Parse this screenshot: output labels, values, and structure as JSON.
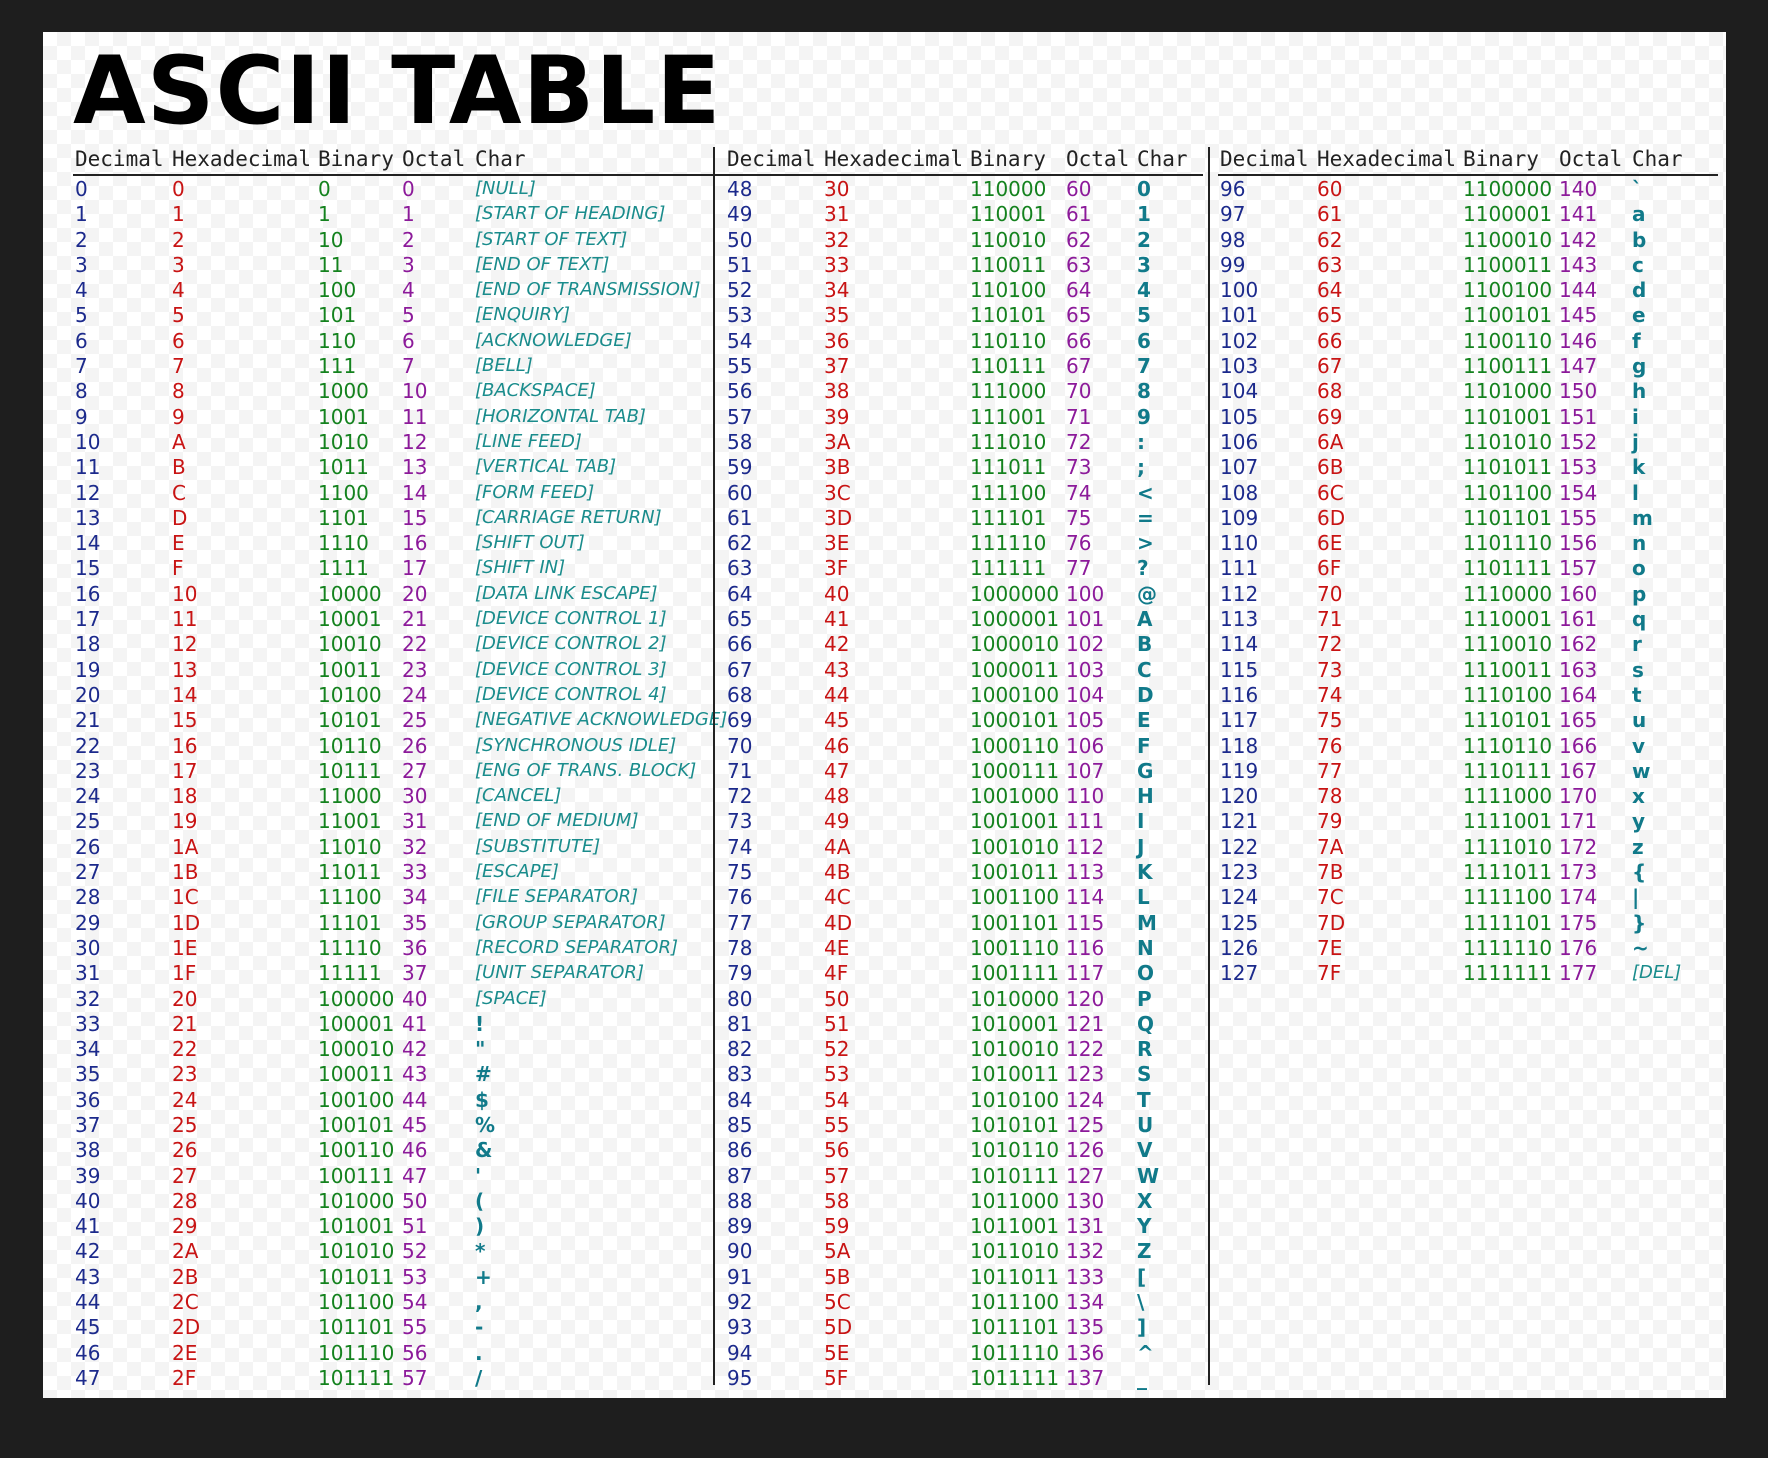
{
  "title": "ASCII TABLE",
  "headers": [
    "Decimal",
    "Hexadecimal",
    "Binary",
    "Octal",
    "Char"
  ],
  "rows": [
    [
      "0",
      "0",
      "0",
      "0",
      "[NULL]"
    ],
    [
      "1",
      "1",
      "1",
      "1",
      "[START OF HEADING]"
    ],
    [
      "2",
      "2",
      "10",
      "2",
      "[START OF TEXT]"
    ],
    [
      "3",
      "3",
      "11",
      "3",
      "[END OF TEXT]"
    ],
    [
      "4",
      "4",
      "100",
      "4",
      "[END OF TRANSMISSION]"
    ],
    [
      "5",
      "5",
      "101",
      "5",
      "[ENQUIRY]"
    ],
    [
      "6",
      "6",
      "110",
      "6",
      "[ACKNOWLEDGE]"
    ],
    [
      "7",
      "7",
      "111",
      "7",
      "[BELL]"
    ],
    [
      "8",
      "8",
      "1000",
      "10",
      "[BACKSPACE]"
    ],
    [
      "9",
      "9",
      "1001",
      "11",
      "[HORIZONTAL TAB]"
    ],
    [
      "10",
      "A",
      "1010",
      "12",
      "[LINE FEED]"
    ],
    [
      "11",
      "B",
      "1011",
      "13",
      "[VERTICAL TAB]"
    ],
    [
      "12",
      "C",
      "1100",
      "14",
      "[FORM FEED]"
    ],
    [
      "13",
      "D",
      "1101",
      "15",
      "[CARRIAGE RETURN]"
    ],
    [
      "14",
      "E",
      "1110",
      "16",
      "[SHIFT OUT]"
    ],
    [
      "15",
      "F",
      "1111",
      "17",
      "[SHIFT IN]"
    ],
    [
      "16",
      "10",
      "10000",
      "20",
      "[DATA LINK ESCAPE]"
    ],
    [
      "17",
      "11",
      "10001",
      "21",
      "[DEVICE CONTROL 1]"
    ],
    [
      "18",
      "12",
      "10010",
      "22",
      "[DEVICE CONTROL 2]"
    ],
    [
      "19",
      "13",
      "10011",
      "23",
      "[DEVICE CONTROL 3]"
    ],
    [
      "20",
      "14",
      "10100",
      "24",
      "[DEVICE CONTROL 4]"
    ],
    [
      "21",
      "15",
      "10101",
      "25",
      "[NEGATIVE ACKNOWLEDGE]"
    ],
    [
      "22",
      "16",
      "10110",
      "26",
      "[SYNCHRONOUS IDLE]"
    ],
    [
      "23",
      "17",
      "10111",
      "27",
      "[ENG OF TRANS. BLOCK]"
    ],
    [
      "24",
      "18",
      "11000",
      "30",
      "[CANCEL]"
    ],
    [
      "25",
      "19",
      "11001",
      "31",
      "[END OF MEDIUM]"
    ],
    [
      "26",
      "1A",
      "11010",
      "32",
      "[SUBSTITUTE]"
    ],
    [
      "27",
      "1B",
      "11011",
      "33",
      "[ESCAPE]"
    ],
    [
      "28",
      "1C",
      "11100",
      "34",
      "[FILE SEPARATOR]"
    ],
    [
      "29",
      "1D",
      "11101",
      "35",
      "[GROUP SEPARATOR]"
    ],
    [
      "30",
      "1E",
      "11110",
      "36",
      "[RECORD SEPARATOR]"
    ],
    [
      "31",
      "1F",
      "11111",
      "37",
      "[UNIT SEPARATOR]"
    ],
    [
      "32",
      "20",
      "100000",
      "40",
      "[SPACE]"
    ],
    [
      "33",
      "21",
      "100001",
      "41",
      "!"
    ],
    [
      "34",
      "22",
      "100010",
      "42",
      "\""
    ],
    [
      "35",
      "23",
      "100011",
      "43",
      "#"
    ],
    [
      "36",
      "24",
      "100100",
      "44",
      "$"
    ],
    [
      "37",
      "25",
      "100101",
      "45",
      "%"
    ],
    [
      "38",
      "26",
      "100110",
      "46",
      "&"
    ],
    [
      "39",
      "27",
      "100111",
      "47",
      "'"
    ],
    [
      "40",
      "28",
      "101000",
      "50",
      "("
    ],
    [
      "41",
      "29",
      "101001",
      "51",
      ")"
    ],
    [
      "42",
      "2A",
      "101010",
      "52",
      "*"
    ],
    [
      "43",
      "2B",
      "101011",
      "53",
      "+"
    ],
    [
      "44",
      "2C",
      "101100",
      "54",
      ","
    ],
    [
      "45",
      "2D",
      "101101",
      "55",
      "-"
    ],
    [
      "46",
      "2E",
      "101110",
      "56",
      "."
    ],
    [
      "47",
      "2F",
      "101111",
      "57",
      "/"
    ],
    [
      "48",
      "30",
      "110000",
      "60",
      "0"
    ],
    [
      "49",
      "31",
      "110001",
      "61",
      "1"
    ],
    [
      "50",
      "32",
      "110010",
      "62",
      "2"
    ],
    [
      "51",
      "33",
      "110011",
      "63",
      "3"
    ],
    [
      "52",
      "34",
      "110100",
      "64",
      "4"
    ],
    [
      "53",
      "35",
      "110101",
      "65",
      "5"
    ],
    [
      "54",
      "36",
      "110110",
      "66",
      "6"
    ],
    [
      "55",
      "37",
      "110111",
      "67",
      "7"
    ],
    [
      "56",
      "38",
      "111000",
      "70",
      "8"
    ],
    [
      "57",
      "39",
      "111001",
      "71",
      "9"
    ],
    [
      "58",
      "3A",
      "111010",
      "72",
      ":"
    ],
    [
      "59",
      "3B",
      "111011",
      "73",
      ";"
    ],
    [
      "60",
      "3C",
      "111100",
      "74",
      "<"
    ],
    [
      "61",
      "3D",
      "111101",
      "75",
      "="
    ],
    [
      "62",
      "3E",
      "111110",
      "76",
      ">"
    ],
    [
      "63",
      "3F",
      "111111",
      "77",
      "?"
    ],
    [
      "64",
      "40",
      "1000000",
      "100",
      "@"
    ],
    [
      "65",
      "41",
      "1000001",
      "101",
      "A"
    ],
    [
      "66",
      "42",
      "1000010",
      "102",
      "B"
    ],
    [
      "67",
      "43",
      "1000011",
      "103",
      "C"
    ],
    [
      "68",
      "44",
      "1000100",
      "104",
      "D"
    ],
    [
      "69",
      "45",
      "1000101",
      "105",
      "E"
    ],
    [
      "70",
      "46",
      "1000110",
      "106",
      "F"
    ],
    [
      "71",
      "47",
      "1000111",
      "107",
      "G"
    ],
    [
      "72",
      "48",
      "1001000",
      "110",
      "H"
    ],
    [
      "73",
      "49",
      "1001001",
      "111",
      "I"
    ],
    [
      "74",
      "4A",
      "1001010",
      "112",
      "J"
    ],
    [
      "75",
      "4B",
      "1001011",
      "113",
      "K"
    ],
    [
      "76",
      "4C",
      "1001100",
      "114",
      "L"
    ],
    [
      "77",
      "4D",
      "1001101",
      "115",
      "M"
    ],
    [
      "78",
      "4E",
      "1001110",
      "116",
      "N"
    ],
    [
      "79",
      "4F",
      "1001111",
      "117",
      "O"
    ],
    [
      "80",
      "50",
      "1010000",
      "120",
      "P"
    ],
    [
      "81",
      "51",
      "1010001",
      "121",
      "Q"
    ],
    [
      "82",
      "52",
      "1010010",
      "122",
      "R"
    ],
    [
      "83",
      "53",
      "1010011",
      "123",
      "S"
    ],
    [
      "84",
      "54",
      "1010100",
      "124",
      "T"
    ],
    [
      "85",
      "55",
      "1010101",
      "125",
      "U"
    ],
    [
      "86",
      "56",
      "1010110",
      "126",
      "V"
    ],
    [
      "87",
      "57",
      "1010111",
      "127",
      "W"
    ],
    [
      "88",
      "58",
      "1011000",
      "130",
      "X"
    ],
    [
      "89",
      "59",
      "1011001",
      "131",
      "Y"
    ],
    [
      "90",
      "5A",
      "1011010",
      "132",
      "Z"
    ],
    [
      "91",
      "5B",
      "1011011",
      "133",
      "["
    ],
    [
      "92",
      "5C",
      "1011100",
      "134",
      "\\"
    ],
    [
      "93",
      "5D",
      "1011101",
      "135",
      "]"
    ],
    [
      "94",
      "5E",
      "1011110",
      "136",
      "^"
    ],
    [
      "95",
      "5F",
      "1011111",
      "137",
      "_"
    ],
    [
      "96",
      "60",
      "1100000",
      "140",
      "`"
    ],
    [
      "97",
      "61",
      "1100001",
      "141",
      "a"
    ],
    [
      "98",
      "62",
      "1100010",
      "142",
      "b"
    ],
    [
      "99",
      "63",
      "1100011",
      "143",
      "c"
    ],
    [
      "100",
      "64",
      "1100100",
      "144",
      "d"
    ],
    [
      "101",
      "65",
      "1100101",
      "145",
      "e"
    ],
    [
      "102",
      "66",
      "1100110",
      "146",
      "f"
    ],
    [
      "103",
      "67",
      "1100111",
      "147",
      "g"
    ],
    [
      "104",
      "68",
      "1101000",
      "150",
      "h"
    ],
    [
      "105",
      "69",
      "1101001",
      "151",
      "i"
    ],
    [
      "106",
      "6A",
      "1101010",
      "152",
      "j"
    ],
    [
      "107",
      "6B",
      "1101011",
      "153",
      "k"
    ],
    [
      "108",
      "6C",
      "1101100",
      "154",
      "l"
    ],
    [
      "109",
      "6D",
      "1101101",
      "155",
      "m"
    ],
    [
      "110",
      "6E",
      "1101110",
      "156",
      "n"
    ],
    [
      "111",
      "6F",
      "1101111",
      "157",
      "o"
    ],
    [
      "112",
      "70",
      "1110000",
      "160",
      "p"
    ],
    [
      "113",
      "71",
      "1110001",
      "161",
      "q"
    ],
    [
      "114",
      "72",
      "1110010",
      "162",
      "r"
    ],
    [
      "115",
      "73",
      "1110011",
      "163",
      "s"
    ],
    [
      "116",
      "74",
      "1110100",
      "164",
      "t"
    ],
    [
      "117",
      "75",
      "1110101",
      "165",
      "u"
    ],
    [
      "118",
      "76",
      "1110110",
      "166",
      "v"
    ],
    [
      "119",
      "77",
      "1110111",
      "167",
      "w"
    ],
    [
      "120",
      "78",
      "1111000",
      "170",
      "x"
    ],
    [
      "121",
      "79",
      "1111001",
      "171",
      "y"
    ],
    [
      "122",
      "7A",
      "1111010",
      "172",
      "z"
    ],
    [
      "123",
      "7B",
      "1111011",
      "173",
      "{"
    ],
    [
      "124",
      "7C",
      "1111100",
      "174",
      "|"
    ],
    [
      "125",
      "7D",
      "1111101",
      "175",
      "}"
    ],
    [
      "126",
      "7E",
      "1111110",
      "176",
      "~"
    ],
    [
      "127",
      "7F",
      "1111111",
      "177",
      "[DEL]"
    ]
  ],
  "colors": {
    "decimal": "#1c2a8c",
    "hexadecimal": "#c81414",
    "binary": "#14821e",
    "octal": "#8c1a9a",
    "char": "#117a8a"
  }
}
